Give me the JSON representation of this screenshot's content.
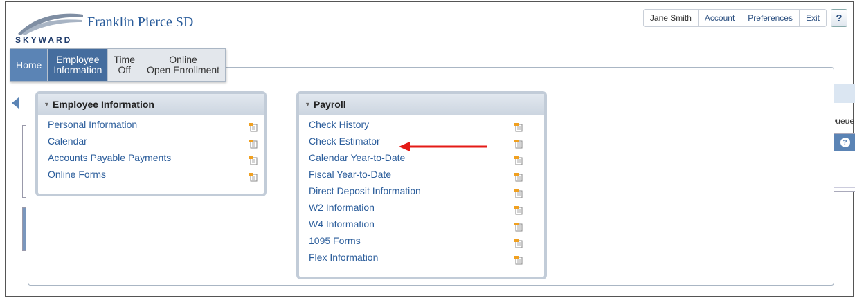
{
  "header": {
    "logo_text": "SKYWARD",
    "district": "Franklin Pierce SD",
    "user": "Jane Smith",
    "nav": [
      "Account",
      "Preferences",
      "Exit"
    ],
    "help": "?"
  },
  "tabs": [
    {
      "label": "Home"
    },
    {
      "label": "Employee Information",
      "line1": "Employee",
      "line2": "Information"
    },
    {
      "label": "Time Off",
      "line1": "Time",
      "line2": "Off"
    },
    {
      "label": "Online Open Enrollment",
      "line1": "Online",
      "line2": "Open Enrollment"
    }
  ],
  "background": {
    "queue_label": "Queue"
  },
  "employee_card": {
    "title": "Employee Information",
    "items": [
      "Personal Information",
      "Calendar",
      "Accounts Payable Payments",
      "Online Forms"
    ]
  },
  "payroll_card": {
    "title": "Payroll",
    "items": [
      "Check History",
      "Check Estimator",
      "Calendar Year-to-Date",
      "Fiscal Year-to-Date",
      "Direct Deposit Information",
      "W2 Information",
      "W4 Information",
      "1095 Forms",
      "Flex Information"
    ]
  },
  "icons": {
    "menu_item": "document-icon",
    "annotation": "red-arrow-icon"
  },
  "colors": {
    "brand": "#2b5d9b",
    "tab_active": "#456d9e",
    "annotation": "#e41b17"
  }
}
